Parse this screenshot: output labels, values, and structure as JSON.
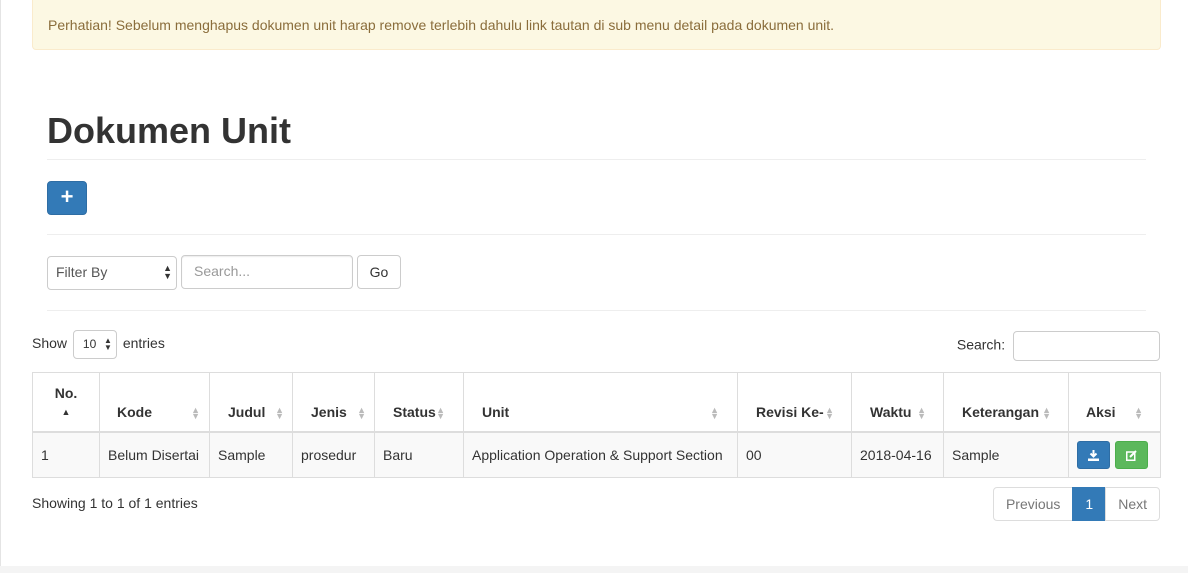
{
  "alert": {
    "text": "Perhatian! Sebelum menghapus dokumen unit harap remove terlebih dahulu link tautan di sub menu detail pada dokumen unit."
  },
  "page_title": "Dokumen Unit",
  "add_button": {
    "label": "+"
  },
  "filter": {
    "select_label": "Filter By",
    "search_placeholder": "Search...",
    "go_label": "Go"
  },
  "datatable": {
    "show_label": "Show",
    "length_value": "10",
    "entries_label": "entries",
    "search_label": "Search:",
    "columns": [
      "No.",
      "Kode",
      "Judul",
      "Jenis",
      "Status",
      "Unit",
      "Revisi Ke-",
      "Waktu",
      "Keterangan",
      "Aksi"
    ],
    "rows": [
      {
        "no": "1",
        "kode": "Belum Disertai",
        "judul": "Sample",
        "jenis": "prosedur",
        "status": "Baru",
        "unit": "Application Operation & Support Section",
        "revisi": "00",
        "waktu": "2018-04-16",
        "keterangan": "Sample"
      }
    ],
    "info": "Showing 1 to 1 of 1 entries",
    "pagination": {
      "previous": "Previous",
      "current": "1",
      "next": "Next"
    }
  },
  "colors": {
    "primary": "#337ab7",
    "success": "#5cb85c",
    "alert_bg": "#fcf8e3",
    "alert_text": "#8a6d3b"
  }
}
